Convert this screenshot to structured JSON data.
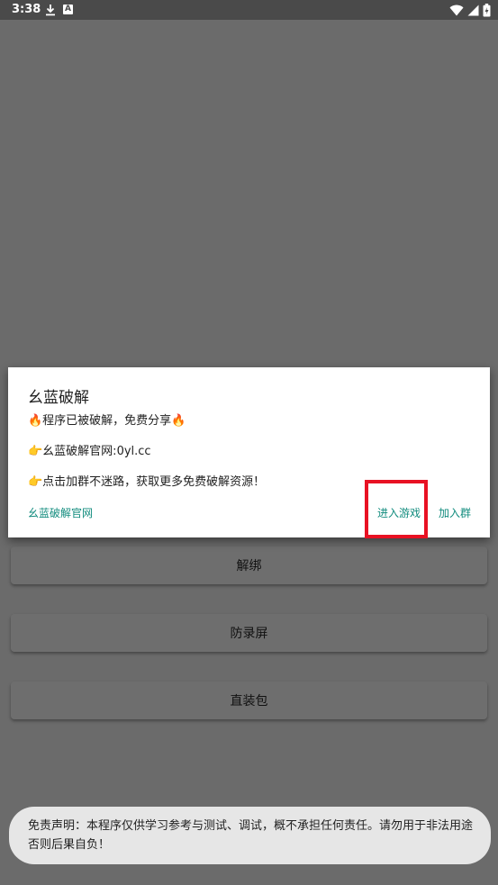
{
  "status_bar": {
    "time": "3:38",
    "icons": [
      "download-icon",
      "a-badge-icon",
      "wifi-icon",
      "signal-icon",
      "battery-icon"
    ]
  },
  "dialog": {
    "title": "幺蓝破解",
    "line1": "🔥程序已被破解，免费分享🔥",
    "line2": "👉幺蓝破解官网:0yl.cc",
    "line3": "👉点击加群不迷路，获取更多免费破解资源！",
    "official_site_label": "幺蓝破解官网",
    "enter_game_label": "进入游戏",
    "join_group_label": "加入群"
  },
  "buttons": {
    "unbind": "解绑",
    "anti_record": "防录屏",
    "direct_install": "直装包"
  },
  "toast": {
    "text": "免责声明：本程序仅供学习参考与测试、调试，概不承担任何责任。请勿用于非法用途否则后果自负！"
  },
  "colors": {
    "accent": "#128c7e",
    "highlight": "#e81123",
    "scrim": "#6b6b6b"
  }
}
